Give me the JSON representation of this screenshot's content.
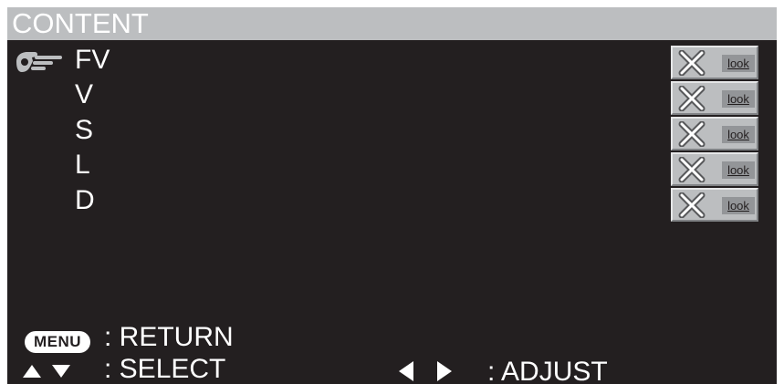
{
  "title": "CONTENT",
  "menu": {
    "items": [
      {
        "label": "FV",
        "status_icon": "x-mark-icon",
        "look_label": "look"
      },
      {
        "label": "V",
        "status_icon": "x-mark-icon",
        "look_label": "look"
      },
      {
        "label": "S",
        "status_icon": "x-mark-icon",
        "look_label": "look"
      },
      {
        "label": "L",
        "status_icon": "x-mark-icon",
        "look_label": "look"
      },
      {
        "label": "D",
        "status_icon": "x-mark-icon",
        "look_label": "look"
      }
    ],
    "selected_index": 0,
    "pointer_icon": "pointing-hand-icon"
  },
  "footer": {
    "menu_key": "MENU",
    "return_label": ": RETURN",
    "select_icons": [
      "up-triangle-icon",
      "down-triangle-icon"
    ],
    "select_label": ": SELECT",
    "adjust_icons": [
      "left-triangle-icon",
      "right-triangle-icon"
    ],
    "adjust_label": ": ADJUST"
  },
  "colors": {
    "background": "#231f20",
    "title_bar": "#bcbec0",
    "text": "#ffffff",
    "cell_face": "#bcbec0",
    "look_face": "#939598"
  }
}
